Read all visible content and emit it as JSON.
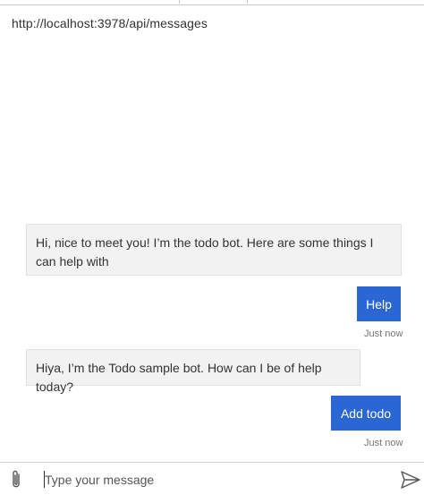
{
  "header": {
    "endpoint_url": "http://localhost:3978/api/messages"
  },
  "conversation": {
    "messages": [
      {
        "from": "bot",
        "text": "Hi, nice to meet you! I’m the todo bot. Here are some things I can help with"
      },
      {
        "from": "user",
        "text": "Help",
        "timestamp": "Just now"
      },
      {
        "from": "bot",
        "text": "Hiya, I’m the Todo sample bot. How can I be of help today?"
      },
      {
        "from": "user",
        "text": "Add todo",
        "timestamp": "Just now"
      }
    ]
  },
  "composer": {
    "placeholder": "Type your message",
    "attach_icon": "paperclip-icon",
    "send_icon": "send-icon"
  },
  "colors": {
    "user_bubble": "#2a66d4",
    "bot_bubble": "#f2f2f2",
    "timestamp": "#767676"
  }
}
